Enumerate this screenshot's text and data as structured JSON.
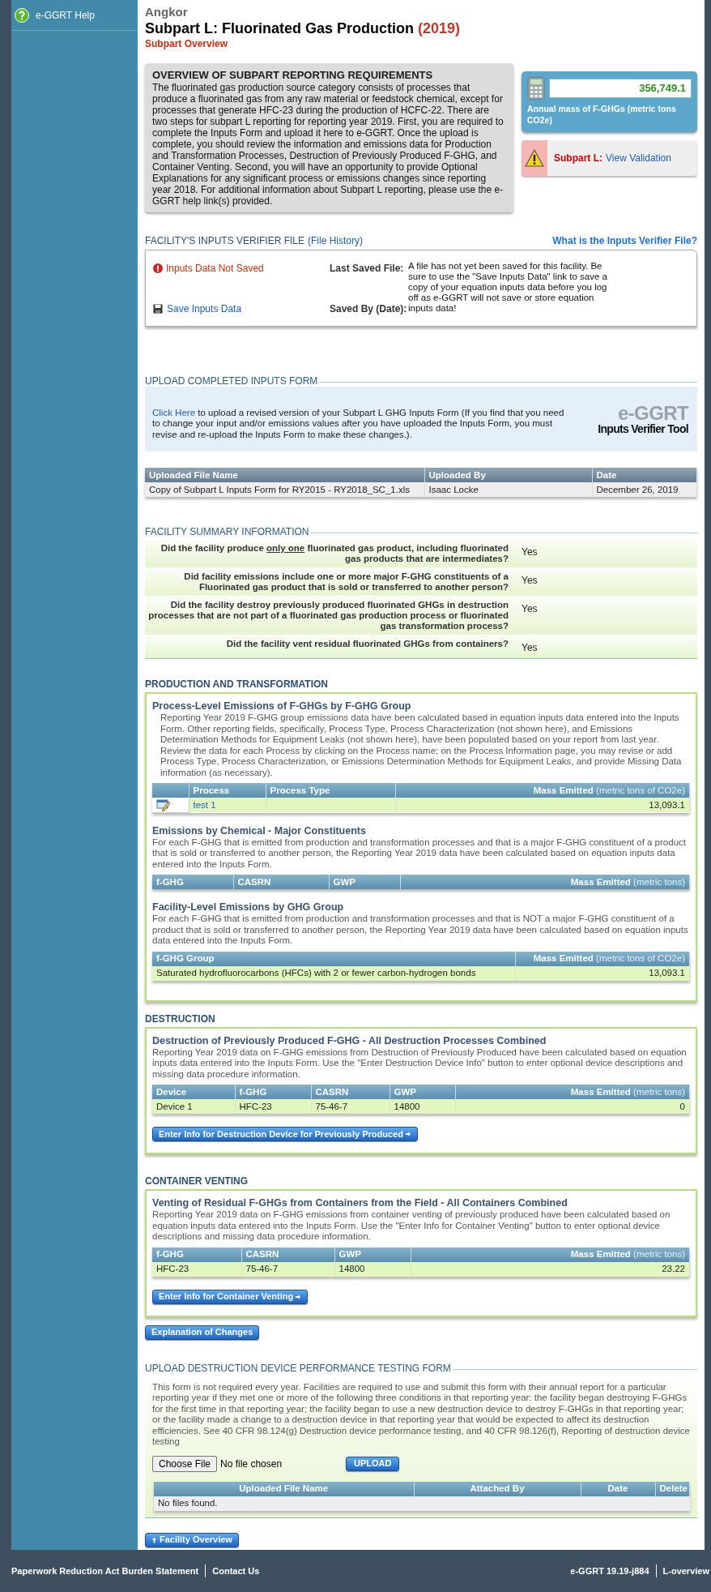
{
  "sidebar": {
    "items": [
      {
        "label": "e-GGRT Help"
      }
    ]
  },
  "header": {
    "facility": "Angkor",
    "title": "Subpart L: Fluorinated Gas Production",
    "year": "(2019)",
    "subtitle": "Subpart Overview"
  },
  "overview": {
    "heading": "OVERVIEW OF SUBPART REPORTING REQUIREMENTS",
    "text": "The fluorinated gas production source category consists of processes that produce a fluorinated gas from any raw material or feedstock chemical, except for processes that generate HFC-23 during the production of HCFC-22. There are two steps for subpart L reporting for reporting year 2019. First, you are required to complete the Inputs Form and upload it here to e-GGRT. Once the upload is complete, you should review the information and emissions data for Production and Transformation Processes, Destruction of Previously Produced F-GHG, and Container Venting. Second, you will have an opportunity to provide Optional Explanations for any significant process or emissions changes since reporting year 2018. For additional information about Subpart L reporting, please use the e-GGRT help link(s) provided."
  },
  "emissions_total": {
    "value": "356,749.1",
    "label": "Annual mass of F-GHGs (metric tons CO2e)"
  },
  "validation": {
    "label": "Subpart L:",
    "link": "View Validation"
  },
  "verifier_file": {
    "heading": "FACILITY'S INPUTS VERIFIER FILE",
    "history_link": "(File History)",
    "help_link": "What is the Inputs Verifier File?",
    "status": "Inputs Data Not Saved",
    "save_link": "Save Inputs Data",
    "last_saved_label": "Last Saved File:",
    "last_saved_text": "A file has not yet been saved for this facility. Be sure to use the \"Save Inputs Data\" link to save a copy of your equation inputs data before you log off as e-GGRT will not save or store equation inputs data!",
    "saved_by_label": "Saved By (Date):"
  },
  "upload_form": {
    "heading": "UPLOAD COMPLETED INPUTS FORM",
    "link": "Click Here",
    "text": " to upload a revised version of your Subpart L GHG Inputs Form (If you find that you need to change your input and/or emissions values after you have uploaded the Inputs Form, you must revise and re-upload the Inputs Form to make these changes.).",
    "logo_top": "e-GGRT",
    "logo_bottom": "Inputs Verifier Tool"
  },
  "uploaded_files": {
    "columns": [
      {
        "label": "Uploaded File Name"
      },
      {
        "label": "Uploaded By"
      },
      {
        "label": "Date"
      }
    ],
    "rows": [
      [
        "Copy of Subpart L Inputs Form for RY2015 - RY2018_SC_1.xls",
        "Isaac Locke",
        "December 26, 2019"
      ]
    ]
  },
  "facility_summary": {
    "heading": "FACILITY SUMMARY INFORMATION",
    "items": [
      {
        "question": [
          "Did the facility produce ",
          "only one",
          " fluorinated gas product, including fluorinated gas products that are intermediates?"
        ],
        "answer": "Yes"
      },
      {
        "question": [
          "Did facility emissions include one or more major F-GHG constituents of a Fluorinated gas product that is sold or transferred to another person?"
        ],
        "answer": "Yes"
      },
      {
        "question": [
          "Did the facility destroy previously produced fluorinated GHGs in destruction processes that are not part of a fluorinated gas production process or fluorinated gas transformation process?"
        ],
        "answer": "Yes"
      },
      {
        "question": [
          "Did the facility vent residual fluorinated GHGs from containers?"
        ],
        "answer": "Yes"
      }
    ]
  },
  "production": {
    "heading": "PRODUCTION AND TRANSFORMATION",
    "subsections": [
      {
        "title": "Process-Level Emissions of F-GHGs by F-GHG Group",
        "text": "Reporting Year 2019 F-GHG group emissions data have been calculated based in equation inputs data entered into the Inputs Form. Other reporting fields, specifically, Process Type, Process Characterization (not shown here), and Emissions Determination Methods for Equipment Leaks (not shown here), have been populated based on your report from last year. Review the data for each Process by clicking on the Process name; on the Process Information page, you may revise or add Process Type, Process Characterization, or Emissions Determination Methods for Equipment Leaks, and provide Missing Data information (as necessary).",
        "table": {
          "edit_icon_column": true,
          "columns": [
            {
              "label": "Process",
              "kind": "link"
            },
            {
              "label": "Process Type"
            },
            {
              "label": "Mass Emitted",
              "unit": "(metric tons of CO2e)",
              "kind": "number"
            }
          ],
          "rows": [
            [
              "test 1",
              "",
              "13,093.1"
            ]
          ]
        }
      },
      {
        "title": "Emissions by Chemical - Major Constituents",
        "text": "For each F-GHG that is emitted from production and transformation processes and that is a major F-GHG constituent of a product that is sold or transferred to another person, the Reporting Year 2019 data have been calculated based on equation inputs data entered into the Inputs Form.",
        "table": {
          "columns": [
            {
              "label": "f-GHG"
            },
            {
              "label": "CASRN"
            },
            {
              "label": "GWP"
            },
            {
              "label": "Mass Emitted",
              "unit": "(metric tons)",
              "kind": "number"
            }
          ]
        }
      },
      {
        "title": "Facility-Level Emissions by GHG Group",
        "text": "For each F-GHG that is emitted from production and transformation processes and that is NOT a major F-GHG constituent of a product that is sold or transferred to another person, the Reporting Year 2019 data have been calculated based on equation inputs data entered into the Inputs Form.",
        "table": {
          "columns": [
            {
              "label": "f-GHG Group"
            },
            {
              "label": "Mass Emitted",
              "unit": "(metric tons of CO2e)",
              "kind": "number"
            }
          ],
          "rows": [
            [
              "Saturated hydrofluorocarbons (HFCs) with 2 or fewer carbon-hydrogen bonds",
              "13,093.1"
            ]
          ]
        }
      }
    ]
  },
  "destruction": {
    "heading": "DESTRUCTION",
    "title": "Destruction of Previously Produced F-GHG - All Destruction Processes Combined",
    "text": "Reporting Year 2019 data on F-GHG emissions from Destruction of Previously Produced have been calculated based on equation inputs data entered into the Inputs Form. Use the \"Enter Destruction Device Info\" button to enter optional device descriptions and missing data procedure information.",
    "table": {
      "columns": [
        {
          "label": "Device"
        },
        {
          "label": "f-GHG"
        },
        {
          "label": "CASRN"
        },
        {
          "label": "GWP"
        },
        {
          "label": "Mass Emitted",
          "unit": "(metric tons)",
          "kind": "number"
        }
      ],
      "rows": [
        [
          "Device 1",
          "HFC-23",
          "75-46-7",
          "14800",
          "0"
        ]
      ]
    },
    "button": "Enter Info for Destruction Device for Previously Produced"
  },
  "container_venting": {
    "heading": "CONTAINER VENTING",
    "title": "Venting of Residual F-GHGs from Containers from the Field - All Containers Combined",
    "text": "Reporting Year 2019 data on F-GHG emissions from container venting of previously produced have been calculated based on equation inputs data entered into the Inputs Form. Use the \"Enter Info for Container Venting\" button to enter optional device descriptions and missing data procedure information.",
    "table": {
      "columns": [
        {
          "label": "f-GHG"
        },
        {
          "label": "CASRN"
        },
        {
          "label": "GWP"
        },
        {
          "label": "Mass Emitted",
          "unit": "(metric tons)",
          "kind": "number"
        }
      ],
      "rows": [
        [
          "HFC-23",
          "75-46-7",
          "14800",
          "23.22"
        ]
      ]
    },
    "button": "Enter Info for Container Venting"
  },
  "explanation_button": "Explanation of Changes",
  "device_testing": {
    "heading": "UPLOAD DESTRUCTION DEVICE PERFORMANCE TESTING FORM",
    "text": "This form is not required every year. Facilities are required to use and submit this form with their annual report for a particular reporting year if they met one or more of the following three conditions in that reporting year: the facility began destroying F-GHGs for the first time in that reporting year; the facility began to use a new destruction device to destroy F-GHGs in that reporting year; or the facility made a change to a destruction device in that reporting year that would be expected to affect its destruction efficiencies. See 40 CFR 98.124(g) Destruction device performance testing, and 40 CFR 98.126(f), Reporting of destruction device testing",
    "choose_file": "Choose File",
    "file_status": "No file chosen",
    "upload_button": "UPLOAD",
    "table": {
      "columns": [
        {
          "label": "Uploaded File Name"
        },
        {
          "label": "Attached By"
        },
        {
          "label": "Date"
        },
        {
          "label": "Delete"
        }
      ],
      "empty_message": "No files found."
    }
  },
  "overview_button": "Facility Overview",
  "footer": {
    "left_links": [
      "Paperwork Reduction Act Burden Statement",
      "Contact Us"
    ],
    "right_items": [
      "e-GGRT 19.19-j884",
      "L-overview"
    ]
  }
}
